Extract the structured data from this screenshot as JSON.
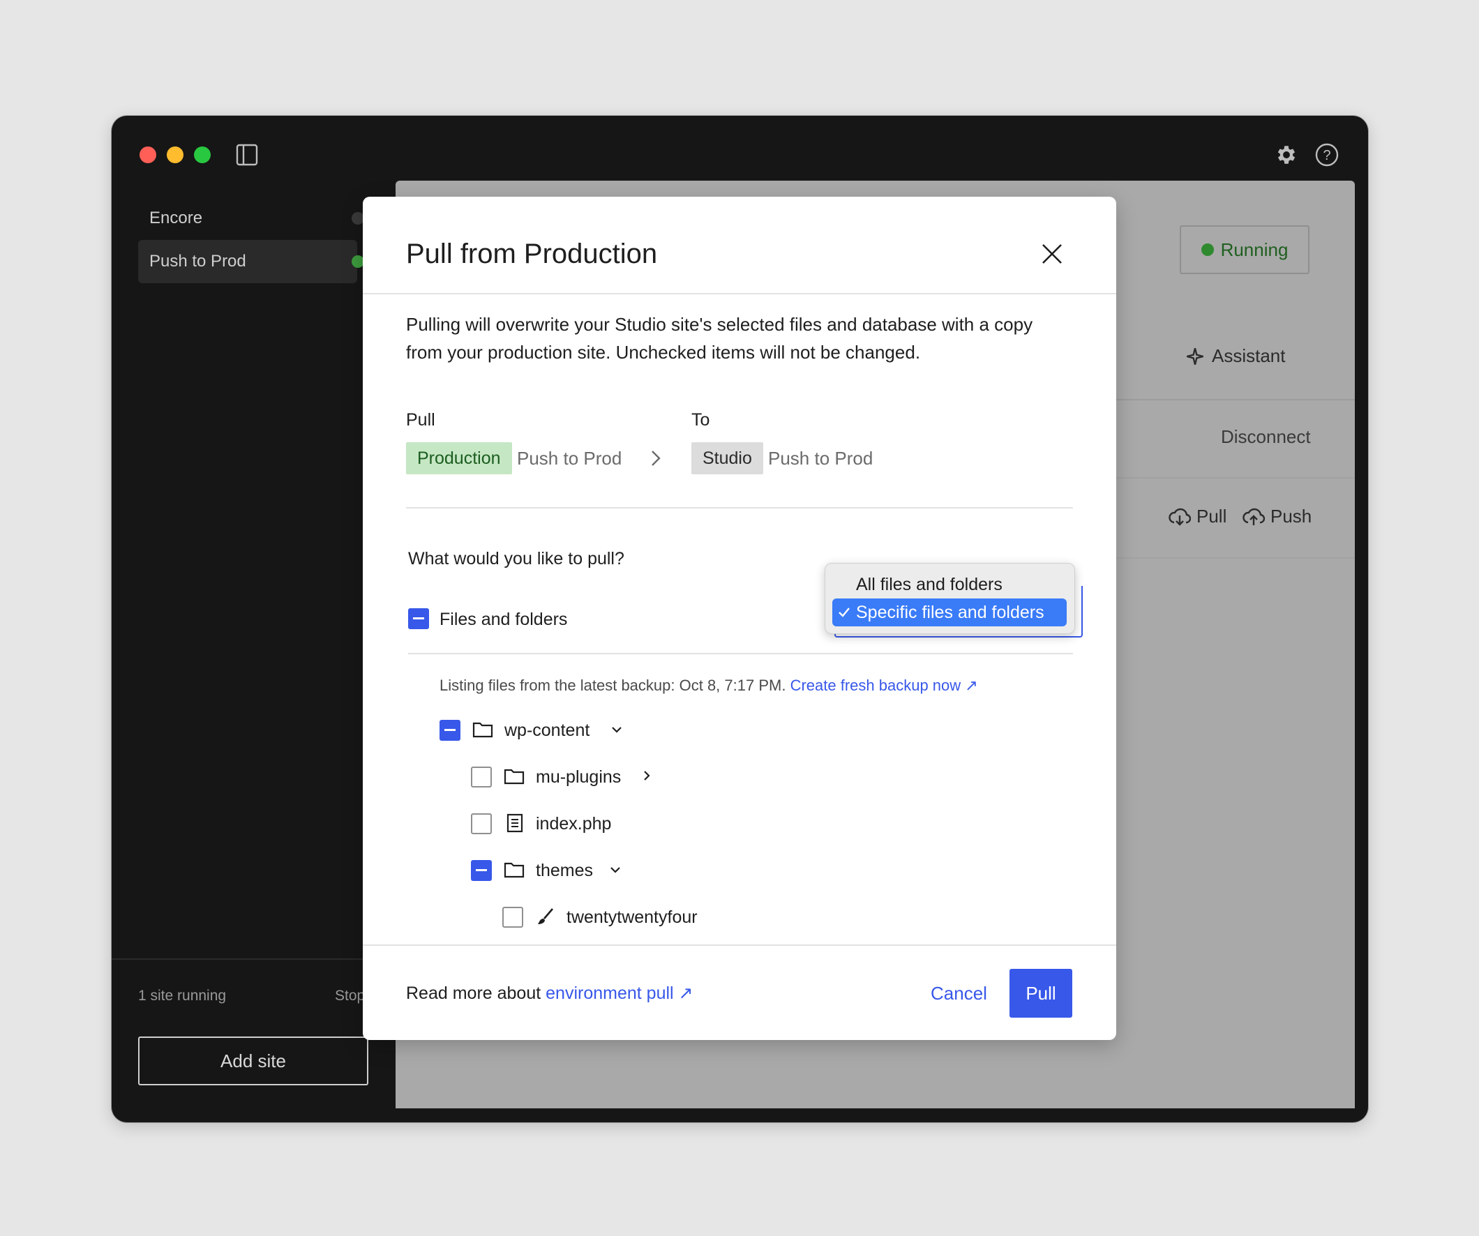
{
  "sidebar": {
    "sites": [
      {
        "name": "Encore",
        "status_color": "#3a3a3a"
      },
      {
        "name": "Push to Prod",
        "status_color": "#3d9b3d"
      }
    ],
    "footer_status": "1 site running",
    "footer_stop": "Stop",
    "add_site_label": "Add site"
  },
  "background": {
    "running_label": "Running",
    "assistant_label": "Assistant",
    "disconnect_label": "Disconnect",
    "pull_label": "Pull",
    "push_label": "Push"
  },
  "modal": {
    "title": "Pull from Production",
    "description_line1": "Pulling will overwrite your Studio site's selected files and database with a copy",
    "description_line2": "from your production site. Unchecked items will not be changed.",
    "pull_heading": "Pull",
    "to_heading": "To",
    "source_env": "Production",
    "source_site": "Push to Prod",
    "target_env": "Studio",
    "target_site": "Push to Prod",
    "question": "What would you like to pull?",
    "files_label": "Files and folders",
    "dropdown_options": [
      "All files and folders",
      "Specific files and folders"
    ],
    "dropdown_selected": "Specific files and folders",
    "backup_text": "Listing files from the latest backup: Oct 8, 7:17 PM.",
    "backup_link": "Create fresh backup now ↗",
    "tree": [
      {
        "name": "wp-content",
        "type": "folder",
        "state": "partial",
        "expanded": true
      },
      {
        "name": "mu-plugins",
        "type": "folder",
        "state": "unchecked",
        "expanded": false
      },
      {
        "name": "index.php",
        "type": "file",
        "state": "unchecked"
      },
      {
        "name": "themes",
        "type": "folder",
        "state": "partial",
        "expanded": true
      },
      {
        "name": "twentytwentyfour",
        "type": "theme",
        "state": "unchecked"
      }
    ],
    "footer_text": "Read more about",
    "footer_link": "environment pull ↗",
    "cancel_label": "Cancel",
    "pull_button_label": "Pull"
  },
  "colors": {
    "accent": "#3858e9",
    "production_tag": "#c6e7c4",
    "studio_tag": "#dcdcdc",
    "running_dot": "#2f8a2f"
  }
}
